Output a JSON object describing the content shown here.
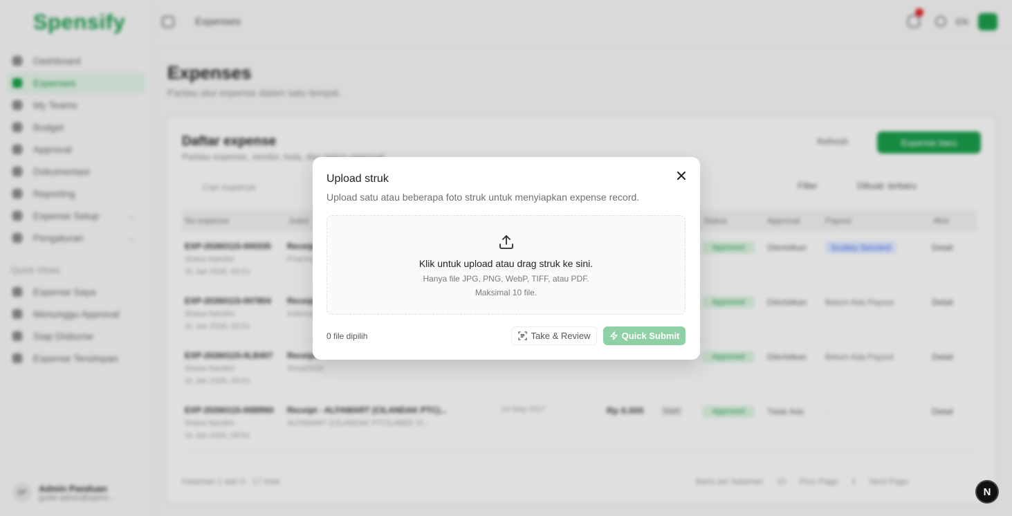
{
  "app": {
    "logo": "Spensify",
    "breadcrumb": "Expenses",
    "topbar": {
      "lang": "EN"
    },
    "sidebar": {
      "items": [
        {
          "label": "Dashboard"
        },
        {
          "label": "Expenses",
          "active": true
        },
        {
          "label": "My Teams"
        },
        {
          "label": "Budget"
        },
        {
          "label": "Approval"
        },
        {
          "label": "Dokumentasi"
        },
        {
          "label": "Reporting"
        },
        {
          "label": "Expense Setup"
        },
        {
          "label": "Pengaturan"
        }
      ],
      "quick_views_label": "Quick Views",
      "quick_views": [
        {
          "label": "Expense Saya"
        },
        {
          "label": "Menunggu Approval"
        },
        {
          "label": "Siap Disburse"
        },
        {
          "label": "Expense Tersimpan"
        }
      ],
      "user": {
        "initials": "AP",
        "name": "Admin Panduan",
        "email": "guide-admin@spens..."
      }
    },
    "page": {
      "title": "Expenses",
      "subtitle": "Pantau alur expense dalam satu tempat."
    },
    "card": {
      "title": "Daftar expense",
      "subtitle": "Pantau expense, vendor, kota, dan status approval.",
      "refresh_label": "Refresh",
      "new_label": "Expense baru",
      "search_placeholder": "Cari expense",
      "filter_label": "Filter",
      "sort_label": "Dibuat: terbaru",
      "columns": [
        "No expense",
        "Judul",
        "Tanggal",
        "Nominal",
        "Status",
        "Approval",
        "Payout",
        "Aksi"
      ],
      "rows": [
        {
          "id": "EXP-20260115-000335",
          "by": "Shasa Nandini",
          "date": "31 Jan 2026, 09:51",
          "title": "Receipt",
          "desc": "Pharmacy",
          "rdate": "",
          "amount": "",
          "cur": "",
          "status": "Approved",
          "approval": "Diterbitkan",
          "payout": "Scotiey Sercient",
          "payout_blue": true,
          "detail": "Detail"
        },
        {
          "id": "EXP-20260115-007804",
          "by": "Shasa Nandini",
          "date": "31 Jan 2026, 09:51",
          "title": "Receipt",
          "desc": "Indomaret",
          "rdate": "",
          "amount": "",
          "cur": "",
          "status": "Approved",
          "approval": "Diterbitkan",
          "payout": "Belum Ada Payout",
          "payout_blue": false,
          "detail": "Detail"
        },
        {
          "id": "EXP-20260115-0LB407",
          "by": "Shasa Nandini",
          "date": "31 Jan 2026, 09:51",
          "title": "Receipt",
          "desc": "Shopi/DSK",
          "rdate": "",
          "amount": "",
          "cur": "",
          "status": "Approved",
          "approval": "Diterbitkan",
          "payout": "Belum Ada Payout",
          "payout_blue": false,
          "detail": "Detail"
        },
        {
          "id": "EXP-20260115-00BR60",
          "by": "Shasa Nandini",
          "date": "31 Jan 2026, 09:51",
          "title": "Receipt - ALFAMART (CILANDAK PTC)...",
          "desc": "ALFAMART (CILANDAK PTC/LABEK SI...",
          "rdate": "14 May 2017",
          "amount": "Rp 6.000",
          "cur": "Inert",
          "status": "Approved",
          "approval": "Tidak Ada",
          "payout": "-",
          "payout_blue": false,
          "detail": "Detail"
        }
      ],
      "pagination_info": "Halaman 1 dari 5 - 17 total",
      "rows_per_page_label": "Baris per halaman",
      "rows_per_page_value": "10",
      "prev_label": "Prev Page",
      "page_number": "1",
      "next_label": "Next Page"
    },
    "next_badge": "N"
  },
  "modal": {
    "title": "Upload struk",
    "description": "Upload satu atau beberapa foto struk untuk menyiapkan expense record.",
    "dropzone": {
      "main_text": "Klik untuk upload atau drag struk ke sini.",
      "sub_text_1": "Hanya file JPG, PNG, WebP, TIFF, atau PDF.",
      "sub_text_2": "Maksimal 10 file."
    },
    "file_count": "0 file dipilih",
    "take_review_label": "Take & Review",
    "quick_submit_label": "Quick Submit"
  },
  "colors": {
    "brand": "#1a9a4a",
    "quick_submit_disabled": "#8fd1a5"
  },
  "icons": [
    "upload-icon",
    "close-icon",
    "scan-icon",
    "lightning-icon"
  ]
}
